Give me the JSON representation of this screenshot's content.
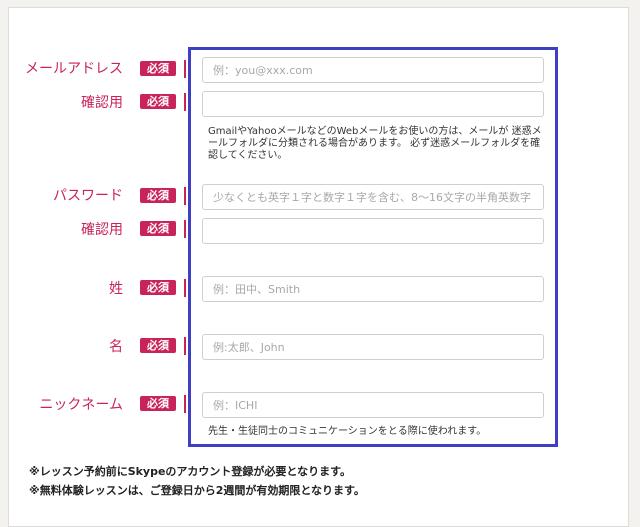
{
  "form": {
    "required_badge": "必須",
    "email": {
      "label": "メールアドレス",
      "placeholder": "例：you@xxx.com",
      "value": ""
    },
    "email_confirm": {
      "label": "確認用",
      "placeholder": "",
      "value": ""
    },
    "email_note": "GmailやYahooメールなどのWebメールをお使いの方は、メールが 迷惑メールフォルダに分類される場合があります。 必ず迷惑メールフォルダを確認してください。",
    "password": {
      "label": "パスワード",
      "placeholder": "少なくとも英字１字と数字１字を含む、8〜16文字の半角英数字",
      "value": ""
    },
    "password_confirm": {
      "label": "確認用",
      "placeholder": "",
      "value": ""
    },
    "last_name": {
      "label": "姓",
      "placeholder": "例：田中、Smith",
      "value": ""
    },
    "first_name": {
      "label": "名",
      "placeholder": "例:太郎、John",
      "value": ""
    },
    "nickname": {
      "label": "ニックネーム",
      "placeholder": "例：ICHI",
      "value": ""
    },
    "nickname_note": "先生・生徒同士のコミュニケーションをとる際に使われます。"
  },
  "footnotes": [
    "※レッスン予約前にSkypeのアカウント登録が必要となります。",
    "※無料体験レッスンは、ご登録日から2週間が有効期限となります。"
  ],
  "colors": {
    "accent": "#c8245a",
    "highlight": "#3f3fc6"
  }
}
